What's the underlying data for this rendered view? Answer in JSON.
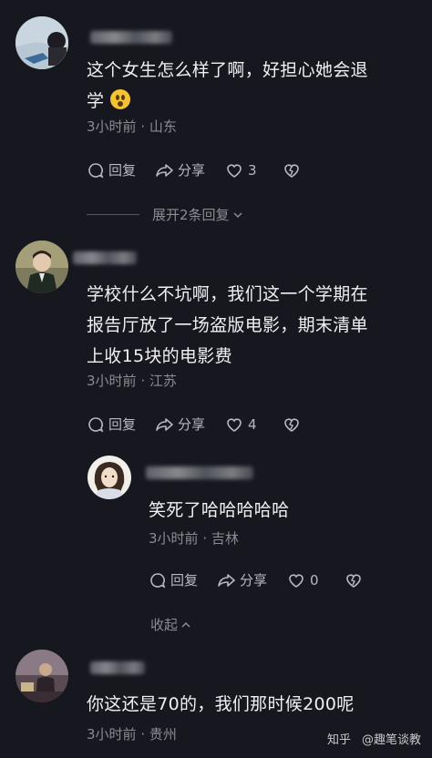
{
  "comments": [
    {
      "text_line1": "这个女生怎么样了啊，好担心她会退",
      "text_line2": "学",
      "emoji": "fearful-face-emoji",
      "time": "3小时前",
      "sep": "·",
      "location": "山东",
      "reply_label": "回复",
      "share_label": "分享",
      "like_count": "3",
      "expand_label": "展开2条回复"
    },
    {
      "text_line1": "学校什么不坑啊，我们这一个学期在",
      "text_line2": "报告厅放了一场盗版电影，期末清单",
      "text_line3": "上收15块的电影费",
      "time": "3小时前",
      "sep": "·",
      "location": "江苏",
      "reply_label": "回复",
      "share_label": "分享",
      "like_count": "4"
    },
    {
      "text_line1": "笑死了哈哈哈哈哈",
      "time": "3小时前",
      "sep": "·",
      "location": "吉林",
      "reply_label": "回复",
      "share_label": "分享",
      "like_count": "0",
      "collapse_label": "收起"
    },
    {
      "text_line1": "你这还是70的，我们那时候200呢",
      "time": "3小时前",
      "sep": "·",
      "location": "贵州"
    }
  ],
  "watermark": {
    "left": "知乎",
    "right": "@趣笔谈教"
  }
}
